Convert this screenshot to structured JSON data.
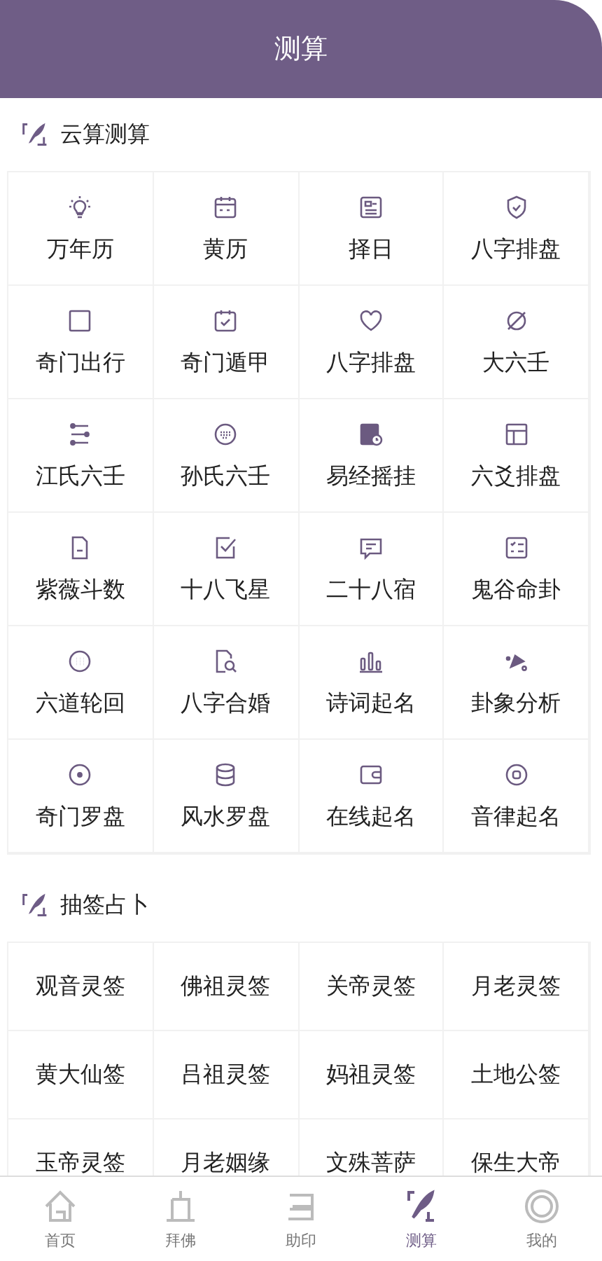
{
  "header": {
    "title": "测算"
  },
  "sections": [
    {
      "title": "云算测算",
      "with_icons": true,
      "items": [
        "万年历",
        "黄历",
        "择日",
        "八字排盘",
        "奇门出行",
        "奇门遁甲",
        "八字排盘",
        "大六壬",
        "江氏六壬",
        "孙氏六壬",
        "易经摇挂",
        "六爻排盘",
        "紫薇斗数",
        "十八飞星",
        "二十八宿",
        "鬼谷命卦",
        "六道轮回",
        "八字合婚",
        "诗词起名",
        "卦象分析",
        "奇门罗盘",
        "风水罗盘",
        "在线起名",
        "音律起名"
      ]
    },
    {
      "title": "抽签占卜",
      "with_icons": false,
      "items": [
        "观音灵签",
        "佛祖灵签",
        "关帝灵签",
        "月老灵签",
        "黄大仙签",
        "吕祖灵签",
        "妈祖灵签",
        "土地公签",
        "玉帝灵签",
        "月老姻缘",
        "文殊菩萨",
        "保生大帝"
      ]
    }
  ],
  "tabbar": [
    {
      "label": "首页",
      "selected": false
    },
    {
      "label": "拜佛",
      "selected": false
    },
    {
      "label": "助印",
      "selected": false
    },
    {
      "label": "测算",
      "selected": true
    },
    {
      "label": "我的",
      "selected": false
    }
  ]
}
